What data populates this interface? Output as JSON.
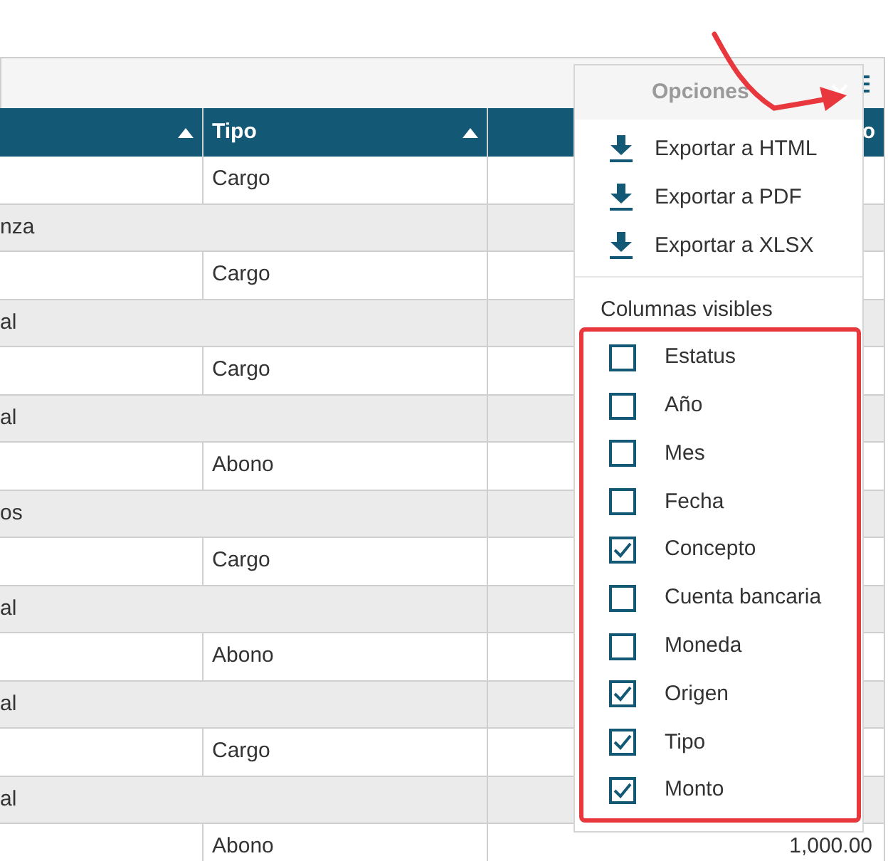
{
  "table": {
    "columns": [
      {
        "sortable": true
      },
      {
        "label": "Tipo",
        "sortable": true
      },
      {
        "label": "o",
        "sortable": false
      }
    ],
    "rows": [
      {
        "kind": "data",
        "column_2": "Cargo"
      },
      {
        "kind": "group",
        "column_1": "nza"
      },
      {
        "kind": "data",
        "column_2": "Cargo"
      },
      {
        "kind": "group",
        "column_1": "al"
      },
      {
        "kind": "data",
        "column_2": "Cargo"
      },
      {
        "kind": "group",
        "column_1": "al"
      },
      {
        "kind": "data",
        "column_2": "Abono"
      },
      {
        "kind": "group",
        "column_1": "os"
      },
      {
        "kind": "data",
        "column_2": "Cargo"
      },
      {
        "kind": "group",
        "column_1": "al"
      },
      {
        "kind": "data",
        "column_2": "Abono"
      },
      {
        "kind": "group",
        "column_1": "al"
      },
      {
        "kind": "data",
        "column_2": "Cargo"
      },
      {
        "kind": "group",
        "column_1": "al"
      },
      {
        "kind": "data",
        "column_2": "Abono",
        "column_3": "1,000.00"
      }
    ]
  },
  "options_menu": {
    "title": "Opciones",
    "export_items": [
      "Exportar a HTML",
      "Exportar a PDF",
      "Exportar a XLSX"
    ],
    "section_title": "Columnas visibles",
    "columns": [
      {
        "label": "Estatus",
        "checked": false
      },
      {
        "label": "Año",
        "checked": false
      },
      {
        "label": "Mes",
        "checked": false
      },
      {
        "label": "Fecha",
        "checked": false
      },
      {
        "label": "Concepto",
        "checked": true
      },
      {
        "label": "Cuenta bancaria",
        "checked": false
      },
      {
        "label": "Moneda",
        "checked": false
      },
      {
        "label": "Origen",
        "checked": true
      },
      {
        "label": "Tipo",
        "checked": true
      },
      {
        "label": "Monto",
        "checked": true
      }
    ]
  }
}
